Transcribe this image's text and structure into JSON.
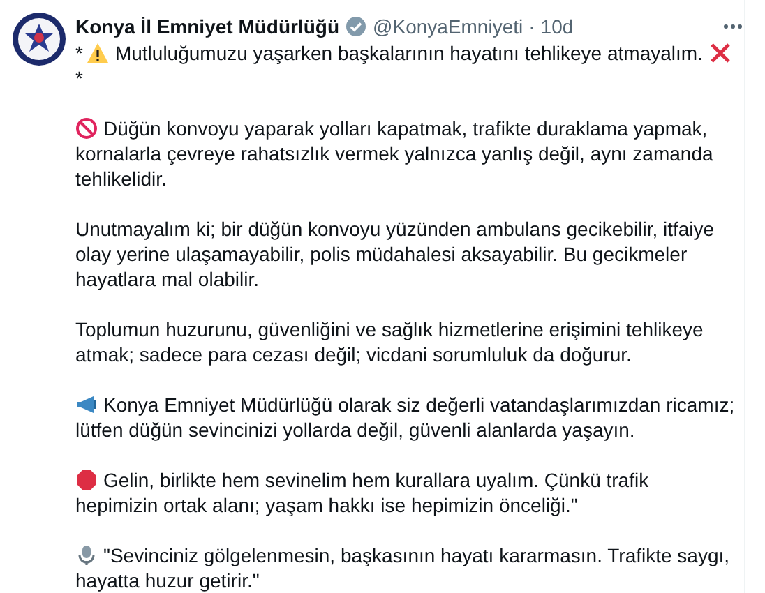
{
  "author": {
    "name": "Konya İl Emniyet Müdürlüğü",
    "verified": true,
    "handle": "@KonyaEmniyeti",
    "separator": "·",
    "time": "10d"
  },
  "intro": {
    "prefix": "*",
    "text": "Mutluluğumuzu yaşarken başkalarının hayatını tehlikeye atmayalım.",
    "suffix": "*"
  },
  "paragraphs": [
    {
      "kind": "prohibited",
      "text": "Düğün konvoyu yaparak yolları kapatmak, trafikte duraklama yapmak, kornalarla çevreye rahatsızlık vermek yalnızca yanlış değil, aynı zamanda tehlikelidir."
    },
    {
      "kind": "plain",
      "text": "Unutmayalım ki; bir düğün konvoyu yüzünden ambulans gecikebilir, itfaiye olay yerine ulaşamayabilir, polis müdahalesi aksayabilir. Bu gecikmeler hayatlara mal olabilir."
    },
    {
      "kind": "plain",
      "text": "Toplumun huzurunu, güvenliğini ve sağlık hizmetlerine erişimini tehlikeye atmak; sadece para cezası değil; vicdani sorumluluk da doğurur."
    },
    {
      "kind": "megaphone",
      "text": "Konya Emniyet Müdürlüğü olarak siz değerli vatandaşlarımızdan ricamız; lütfen düğün sevincinizi yollarda değil, güvenli alanlarda yaşayın."
    },
    {
      "kind": "stop",
      "text": "Gelin, birlikte hem sevinelim hem kurallara uyalım. Çünkü trafik hepimizin ortak alanı; yaşam hakkı ise hepimizin önceliği.\""
    },
    {
      "kind": "microphone",
      "text": "\"Sevinciniz gölgelenmesin, başkasının hayatı kararmasın. Trafikte saygı, hayatta huzur getirir.\""
    }
  ]
}
